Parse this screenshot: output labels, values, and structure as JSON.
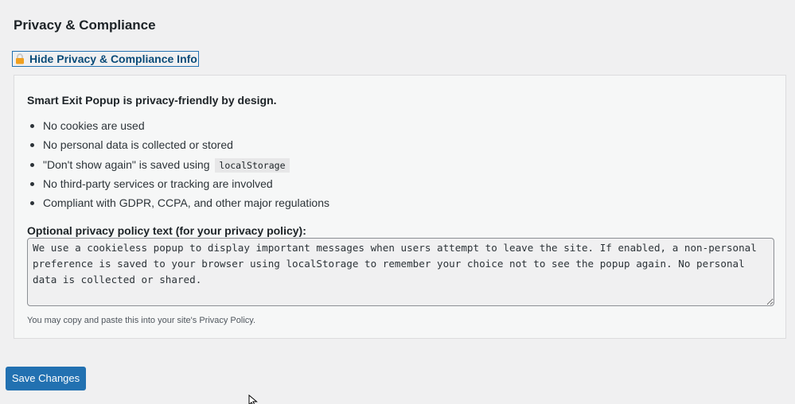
{
  "header": {
    "title": "Privacy & Compliance"
  },
  "toggle": {
    "label": "Hide Privacy & Compliance Info",
    "icon": "lock-icon"
  },
  "info_box": {
    "intro": "Smart Exit Popup is privacy-friendly by design.",
    "features": [
      {
        "text": "No cookies are used"
      },
      {
        "text": "No personal data is collected or stored"
      },
      {
        "text": "\"Don't show again\" is saved using",
        "code": "localStorage"
      },
      {
        "text": "No third-party services or tracking are involved"
      },
      {
        "text": "Compliant with GDPR, CCPA, and other major regulations"
      }
    ],
    "textarea_label": "Optional privacy policy text (for your privacy policy):",
    "policy_text": "We use a cookieless popup to display important messages when users attempt to leave the site. If enabled, a non-personal preference is saved to your browser using localStorage to remember your choice not to see the popup again. No personal data is collected or shared.",
    "hint": "You may copy and paste this into your site's Privacy Policy."
  },
  "footer": {
    "save_label": "Save Changes"
  },
  "colors": {
    "accent": "#2271b1",
    "lock": "#f0a020",
    "background": "#f0f0f1",
    "panel": "#f6f7f7"
  }
}
